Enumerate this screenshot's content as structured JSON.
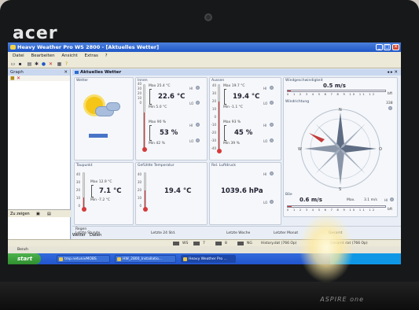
{
  "window": {
    "title": "Heavy Weather Pro WS 2800 - [Aktuelles Wetter]",
    "min": "_",
    "max": "□",
    "close": "✕"
  },
  "menu": [
    "Datei",
    "Bearbeiten",
    "Ansicht",
    "Extras",
    "?"
  ],
  "brand": "acer",
  "model": "ASPIRE one",
  "graph_panel": {
    "title": "Graph",
    "close": "✕",
    "tab1": "Zu zeigen",
    "tab2": "Daten"
  },
  "doc_tab": {
    "title": "Aktuelles Wetter",
    "controls": "◂ ▸ ✕"
  },
  "weather_tile": {
    "title": "Wetter"
  },
  "indoor": {
    "title": "Innen",
    "scale": [
      "40",
      "30",
      "20",
      "10",
      "0"
    ],
    "temp_max": "Max 25.4 °C",
    "temp": "22.6 °C",
    "temp_min": "Min 5.0 °C",
    "hum_scale": [
      "100",
      "80",
      "60",
      "40",
      "20",
      "0"
    ],
    "hum_max": "Max 90 %",
    "hum": "53 %",
    "hum_min": "Min 42 %",
    "temp_fill": 0.56
  },
  "outdoor": {
    "title": "Aussen",
    "scale": [
      "40",
      "30",
      "20",
      "10",
      "0",
      "-10",
      "-20",
      "-30",
      "-40"
    ],
    "temp_max": "Max 19.7 °C",
    "temp": "19.4 °C",
    "temp_min": "Min -1.1 °C",
    "hum_max": "Max 93 %",
    "hum": "45 %",
    "hum_min": "Min 39 %",
    "temp_fill": 0.74
  },
  "hilo": {
    "hi": "HI",
    "lo": "LO"
  },
  "wind": {
    "speed_title": "Windgeschwindigkeit",
    "speed": "0.5 m/s",
    "ticks": "0 1 2 3 4 5 6 7 8 9 10 11 12",
    "unit": "bft",
    "direction_title": "Windrichtung",
    "direction_value": "338",
    "compass": [
      "N",
      "S",
      "W",
      "O"
    ]
  },
  "gust": {
    "title": "Böe",
    "speed": "0.6 m/s",
    "max": "Max.",
    "max_val": "3.1 m/s"
  },
  "dewpoint": {
    "title": "Taupunkt",
    "scale": [
      "40",
      "30",
      "20",
      "10",
      "0"
    ],
    "max": "Max 12.9 °C",
    "val": "7.1 °C",
    "min": "Min -7.2 °C",
    "fill": 0.3
  },
  "feels": {
    "title": "Gefühlte Temperatur",
    "scale": [
      "40",
      "30",
      "20",
      "10",
      "0"
    ],
    "val": "19.4 °C",
    "fill": 0.5
  },
  "pressure": {
    "title": "Rel. Luftdruck",
    "val": "1039.6 hPa"
  },
  "footer": {
    "rain": "Regen",
    "last_hour": "Letzte Stunde",
    "last_24": "Letzte 24 Std.",
    "last_week": "Letzte Woche",
    "last_month": "Letzter Monat",
    "total": "Gesamt"
  },
  "status": {
    "a": "WS",
    "b": "7",
    "c": "8",
    "d": "NG",
    "history": "History.dat (766 Op)",
    "history2": "Gesamt dat (766 Op)"
  },
  "taskbar": {
    "bench": "Bench",
    "start": "start",
    "tasks": [
      "tmp.netunivMOBS",
      "HW_2800_Installatio...",
      "Heavy Weather Pro ..."
    ]
  }
}
